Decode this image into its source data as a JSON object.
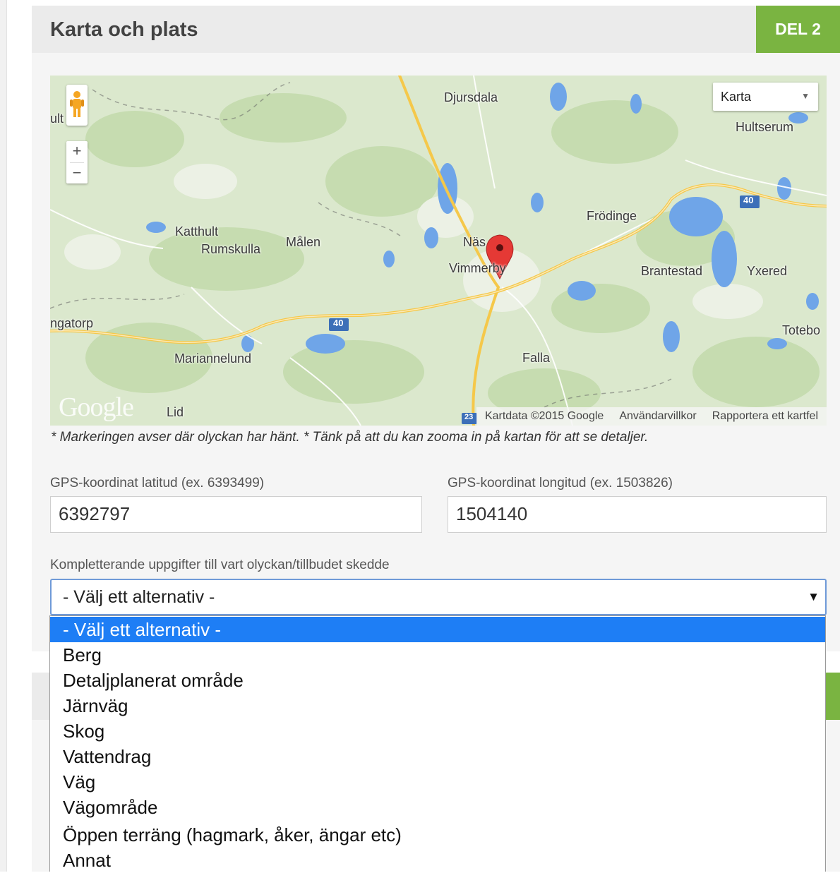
{
  "section": {
    "title": "Karta och plats",
    "badge": "DEL 2"
  },
  "map": {
    "place_labels": {
      "djursdala": "Djursdala",
      "hultserum": "Hultserum",
      "ult": "ult",
      "frodinge": "Frödinge",
      "katthult": "Katthult",
      "rumskulla": "Rumskulla",
      "malen": "Målen",
      "nas": "Näs",
      "vimmerby": "Vimmerby",
      "brantestad": "Brantestad",
      "yxered": "Yxered",
      "ngatorp": "ngatorp",
      "totebo": "Totebo",
      "mariannelund": "Mariannelund",
      "falla": "Falla",
      "lid": "Lid"
    },
    "road_numbers": [
      "40",
      "40",
      "23"
    ],
    "map_type": {
      "selected": "Karta"
    },
    "zoom": {
      "in": "+",
      "out": "−"
    },
    "google_logo": "Google",
    "attribution": {
      "data": "Kartdata ©2015 Google",
      "terms": "Användarvillkor",
      "report": "Rapportera ett kartfel"
    }
  },
  "note": "* Markeringen avser där olyckan har hänt. * Tänk på att du kan zooma in på kartan för att se detaljer.",
  "gps": {
    "lat_label": "GPS-koordinat latitud (ex. 6393499)",
    "lat_value": "6392797",
    "lon_label": "GPS-koordinat longitud (ex. 1503826)",
    "lon_value": "1504140"
  },
  "location_select": {
    "label": "Kompletterande uppgifter till vart olyckan/tillbudet skedde",
    "selected": "- Välj ett alternativ -",
    "options": [
      "- Välj ett alternativ -",
      "Berg",
      "Detaljplanerat område",
      "Järnväg",
      "Skog",
      "Vattendrag",
      "Väg",
      "Vägområde",
      "Öppen terräng (hagmark, åker, ängar etc)",
      "Annat"
    ],
    "highlighted_index": 0
  },
  "colors": {
    "accent_green": "#7ab441",
    "selection_blue": "#1e7ef5",
    "map_land": "#dbe8cd",
    "map_water": "#6fa5e8",
    "map_road_major": "#f5c84a",
    "marker_red": "#e53935"
  }
}
